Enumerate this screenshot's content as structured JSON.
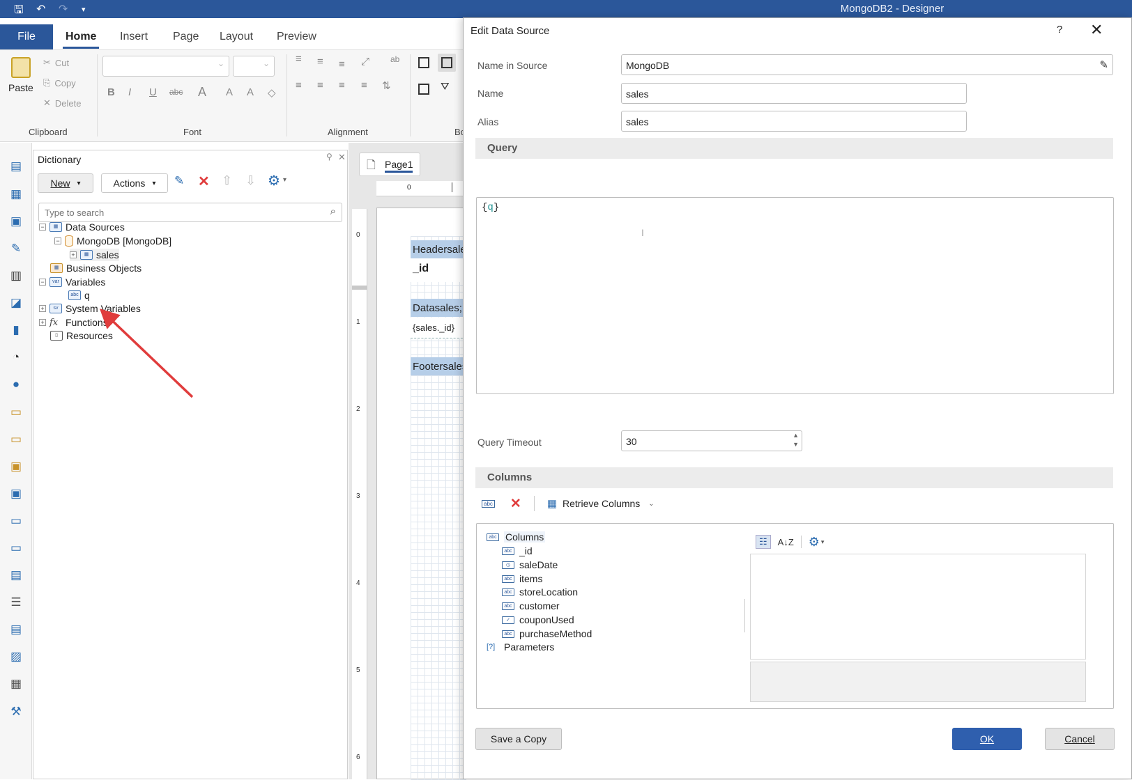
{
  "window": {
    "title": "MongoDB2 - Designer"
  },
  "ribbon": {
    "tabs": [
      {
        "label": "File"
      },
      {
        "label": "Home"
      },
      {
        "label": "Insert"
      },
      {
        "label": "Page"
      },
      {
        "label": "Layout"
      },
      {
        "label": "Preview"
      }
    ],
    "clipboard": {
      "paste": "Paste",
      "cut": "Cut",
      "copy": "Copy",
      "delete": "Delete",
      "group": "Clipboard"
    },
    "groups": {
      "font": "Font",
      "alignment": "Alignment",
      "borders_partial": "Bo"
    }
  },
  "dictionary": {
    "title": "Dictionary",
    "new_label": "New",
    "actions_label": "Actions",
    "search_placeholder": "Type to search",
    "tree": {
      "data_sources": "Data Sources",
      "mongodb": "MongoDB [MongoDB]",
      "sales": "sales",
      "business_objects": "Business Objects",
      "variables": "Variables",
      "q": "q",
      "system_variables": "System Variables",
      "functions": "Functions",
      "resources": "Resources"
    }
  },
  "designer": {
    "page_tab": "Page1",
    "ruler_top": "0",
    "ruler_marks": [
      "0",
      "1",
      "2",
      "3",
      "4",
      "5",
      "6"
    ],
    "bands": {
      "header": "Headersales",
      "header_content": "_id",
      "data": "Datasales; D",
      "data_content": "{sales._id}",
      "footer": "Footersales"
    }
  },
  "dialog": {
    "title": "Edit Data Source",
    "help": "?",
    "fields": {
      "name_in_source_label": "Name in Source",
      "name_in_source_value": "MongoDB",
      "name_label": "Name",
      "name_value": "sales",
      "alias_label": "Alias",
      "alias_value": "sales"
    },
    "query_section": "Query",
    "query_open": "{",
    "query_var": "q",
    "query_close": "}",
    "timeout_label": "Query Timeout",
    "timeout_value": "30",
    "columns_section": "Columns",
    "retrieve_columns": "Retrieve Columns",
    "columns_tree": {
      "root": "Columns",
      "items": [
        "_id",
        "saleDate",
        "items",
        "storeLocation",
        "customer",
        "couponUsed",
        "purchaseMethod"
      ],
      "parameters": "Parameters"
    },
    "buttons": {
      "save_copy": "Save a Copy",
      "ok": "OK",
      "cancel": "Cancel"
    }
  },
  "colors": {
    "accent": "#2b579a",
    "arrow": "#e03c3c",
    "ok_button": "#2f5fae",
    "band": "#b6cee8"
  }
}
